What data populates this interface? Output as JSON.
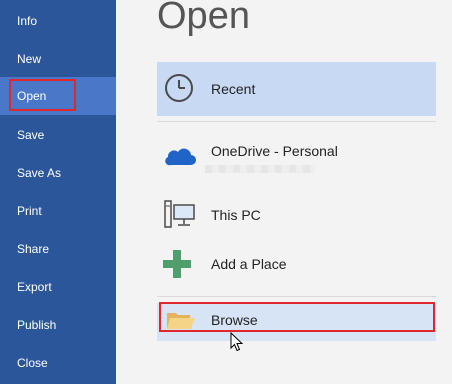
{
  "sidebar": {
    "items": [
      {
        "label": "Info"
      },
      {
        "label": "New"
      },
      {
        "label": "Open",
        "active": true
      },
      {
        "label": "Save"
      },
      {
        "label": "Save As"
      },
      {
        "label": "Print"
      },
      {
        "label": "Share"
      },
      {
        "label": "Export"
      },
      {
        "label": "Publish"
      },
      {
        "label": "Close"
      }
    ]
  },
  "main": {
    "title": "Open",
    "places": [
      {
        "label": "Recent",
        "icon": "clock-icon",
        "state": "selected"
      },
      {
        "label": "OneDrive - Personal",
        "icon": "cloud-icon",
        "state": "normal"
      },
      {
        "label": "This PC",
        "icon": "computer-icon",
        "state": "normal"
      },
      {
        "label": "Add a Place",
        "icon": "plus-icon",
        "state": "normal"
      },
      {
        "label": "Browse",
        "icon": "folder-icon",
        "state": "hover"
      }
    ]
  },
  "colors": {
    "sidebar_bg": "#2b579a",
    "sidebar_active": "#4a77c7",
    "highlight_outline": "#e2262d",
    "recent_selected": "#c8daf3",
    "browse_hover": "#d7e4f5"
  }
}
